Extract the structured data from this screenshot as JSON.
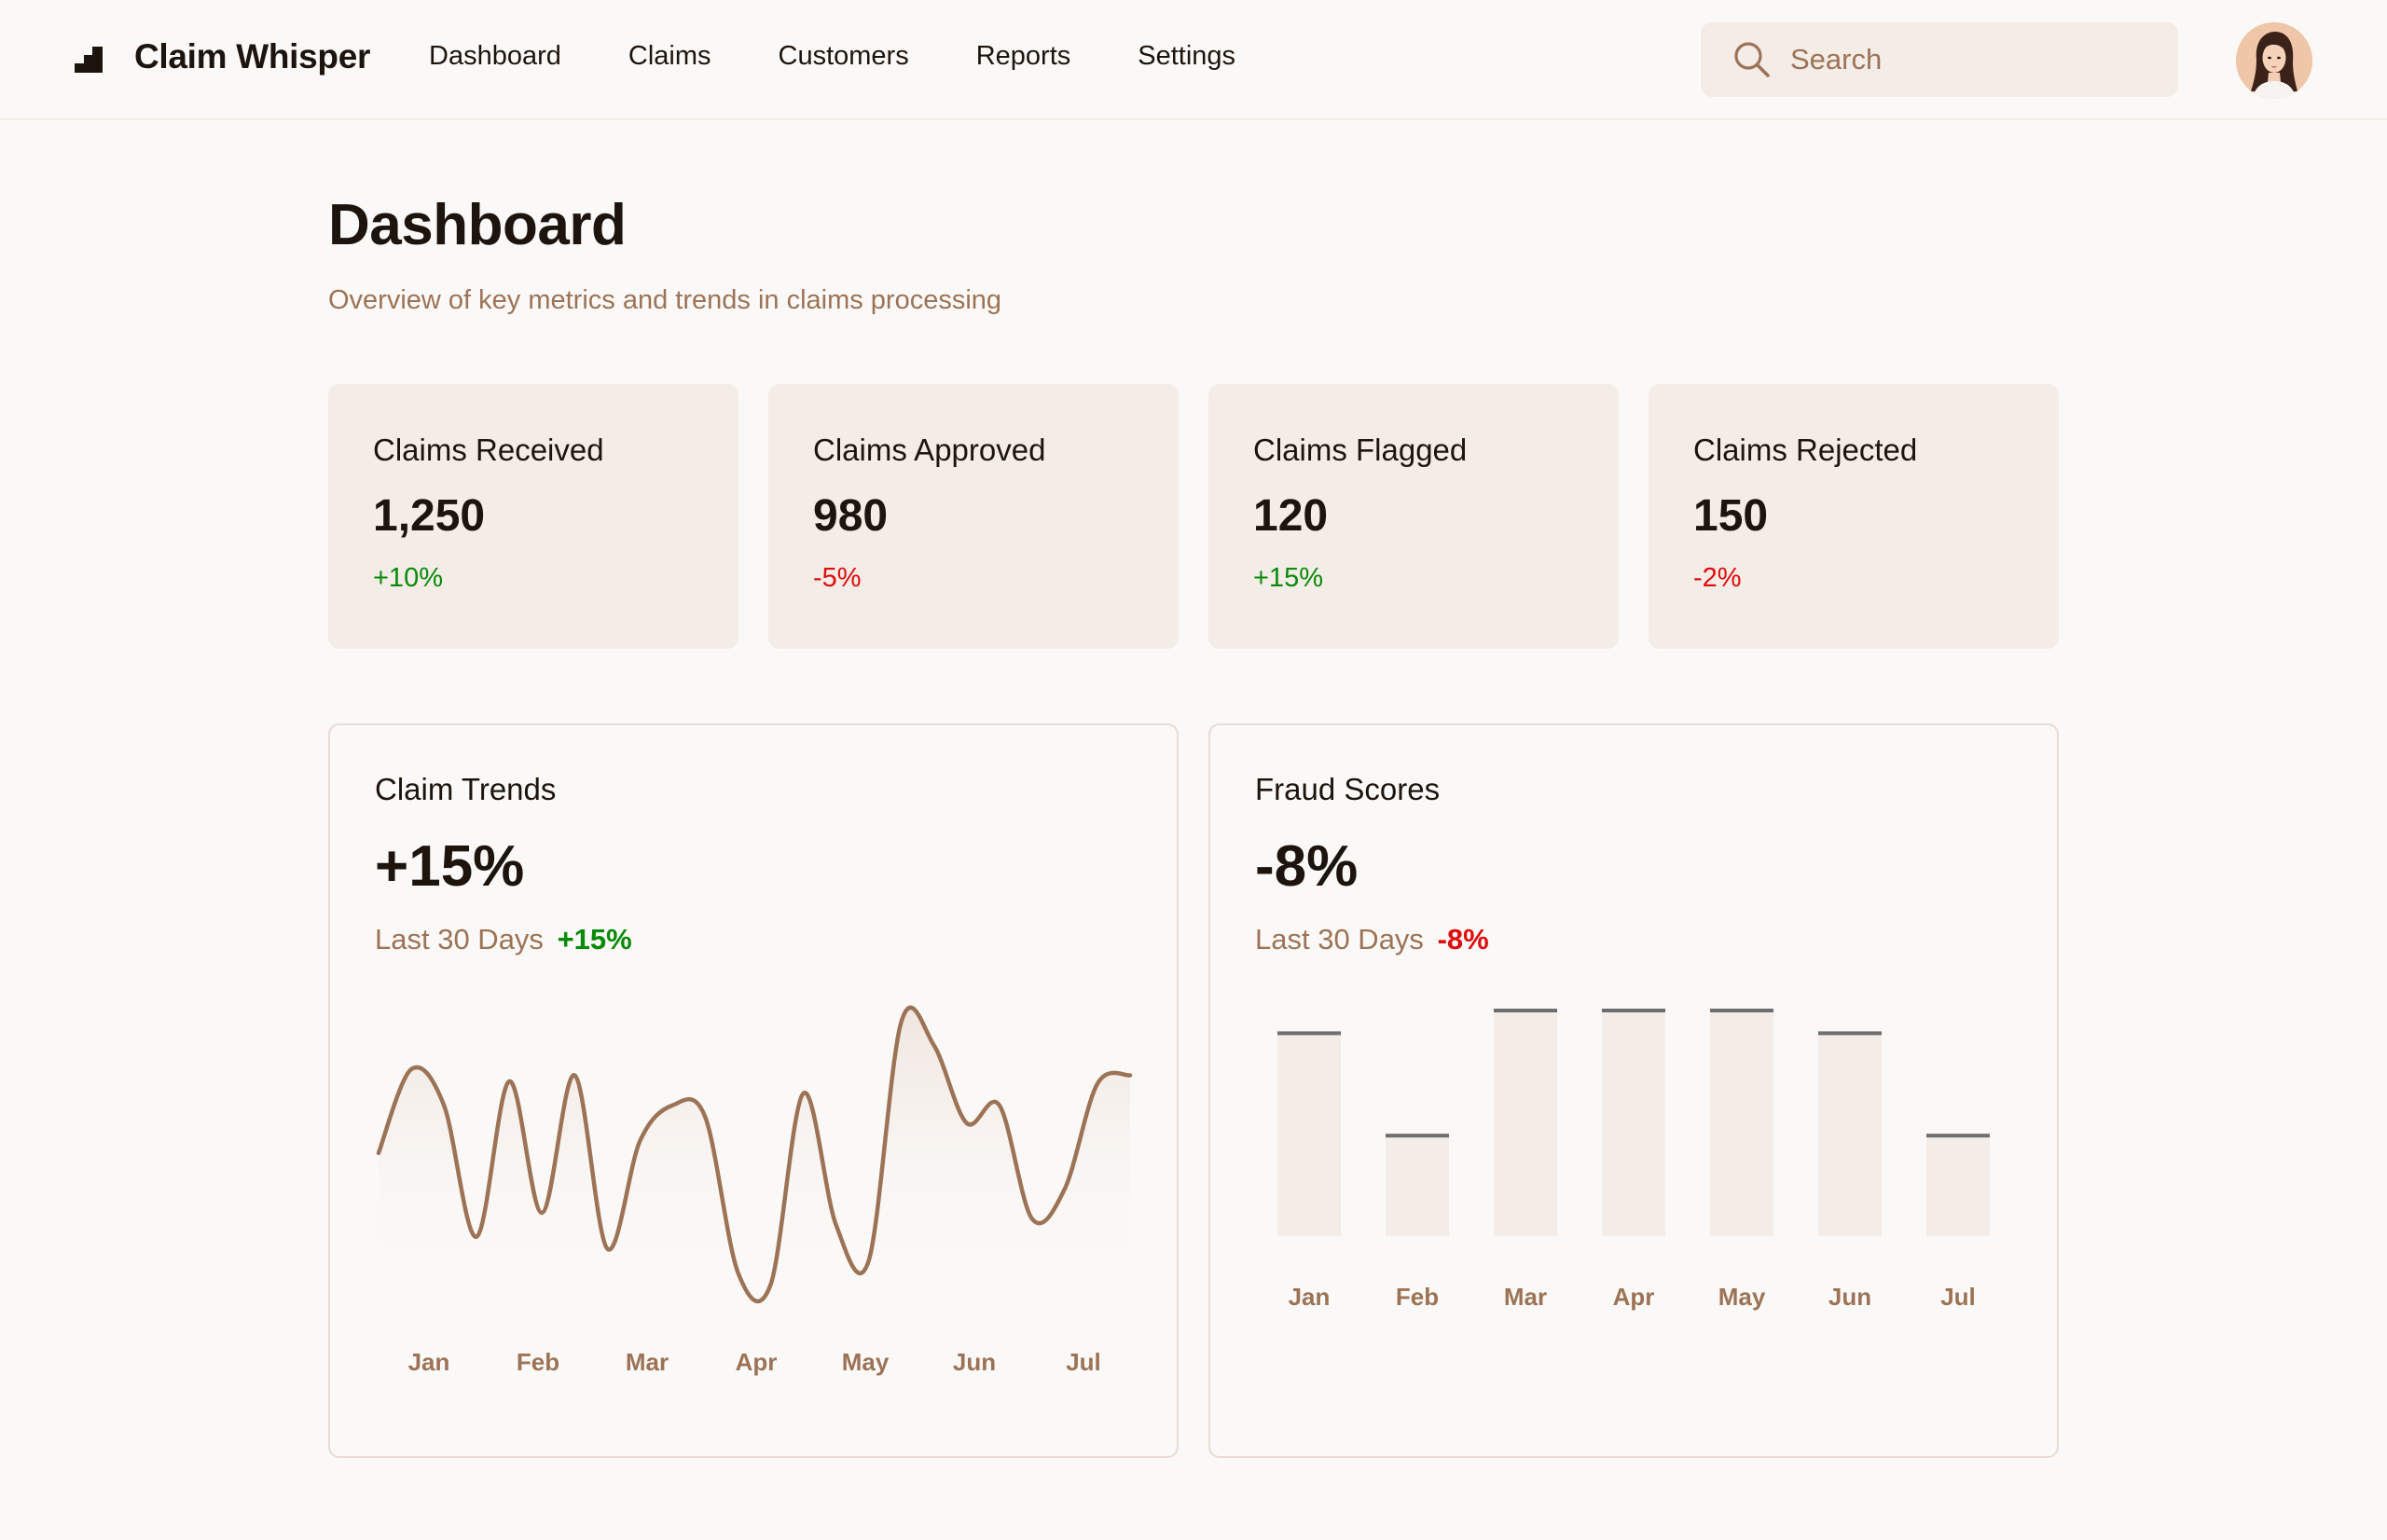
{
  "app": {
    "brand": "Claim Whisper"
  },
  "nav": {
    "items": [
      {
        "label": "Dashboard"
      },
      {
        "label": "Claims"
      },
      {
        "label": "Customers"
      },
      {
        "label": "Reports"
      },
      {
        "label": "Settings"
      }
    ]
  },
  "search": {
    "placeholder": "Search",
    "value": ""
  },
  "page": {
    "title": "Dashboard",
    "subtitle": "Overview of key metrics and trends in claims processing"
  },
  "stats": [
    {
      "label": "Claims Received",
      "value": "1,250",
      "change": "+10%"
    },
    {
      "label": "Claims Approved",
      "value": "980",
      "change": "-5%"
    },
    {
      "label": "Claims Flagged",
      "value": "120",
      "change": "+15%"
    },
    {
      "label": "Claims Rejected",
      "value": "150",
      "change": "-2%"
    }
  ],
  "colors": {
    "accent": "#9c7356",
    "positive": "#078a07",
    "negative": "#e00b0b",
    "card_bg": "#f4ece7",
    "bar_cap": "#6e6e6e"
  },
  "charts": {
    "trends": {
      "title": "Claim Trends",
      "big": "+15%",
      "period": "Last 30 Days",
      "delta": "+15%"
    },
    "fraud": {
      "title": "Fraud Scores",
      "big": "-8%",
      "period": "Last 30 Days",
      "delta": "-8%"
    }
  },
  "chart_data": [
    {
      "type": "line",
      "title": "Claim Trends",
      "categories": [
        "Jan",
        "Feb",
        "Mar",
        "Apr",
        "May",
        "Jun",
        "Jul"
      ],
      "values": [
        110,
        180,
        150,
        40,
        170,
        60,
        175,
        30,
        120,
        150,
        140,
        10,
        0,
        160,
        50,
        20,
        220,
        200,
        135,
        150,
        55,
        80,
        168,
        175
      ],
      "ylim": [
        0,
        230
      ],
      "grid": false,
      "legend": "none"
    },
    {
      "type": "bar",
      "title": "Fraud Scores",
      "categories": [
        "Jan",
        "Feb",
        "Mar",
        "Apr",
        "May",
        "Jun",
        "Jul"
      ],
      "values": [
        90,
        45,
        100,
        100,
        100,
        90,
        45
      ],
      "ylim": [
        0,
        100
      ],
      "grid": false,
      "legend": "none"
    }
  ]
}
